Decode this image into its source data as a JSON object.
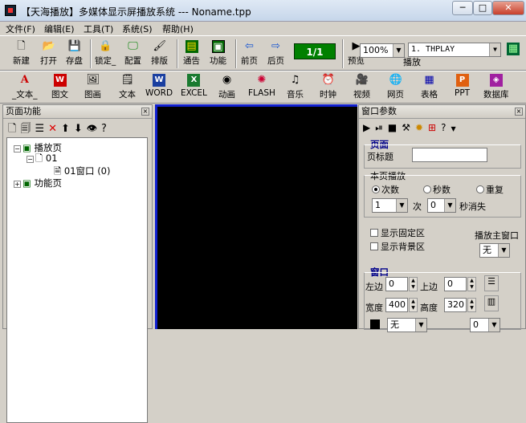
{
  "window": {
    "title": "【天海播放】多媒体显示屏播放系统 --- Noname.tpp",
    "minimize": "─",
    "maximize": "□",
    "close": "✕"
  },
  "menu": [
    "文件(F)",
    "编辑(E)",
    "工具(T)",
    "系统(S)",
    "帮助(H)"
  ],
  "toolbar1": {
    "new": "新建",
    "open": "打开",
    "save": "存盘",
    "lock": "锁定_",
    "config": "配置",
    "arrange": "排版",
    "notice": "通告",
    "function": "功能",
    "prev": "前页",
    "next": "后页",
    "page_counter": "1/1",
    "preview": "预览",
    "zoom": "100%",
    "play": "播放",
    "play_file": "1. THPLAY"
  },
  "toolbar2": [
    "_文本_",
    "图文",
    "图画",
    "文本",
    "WORD",
    "EXCEL",
    "动画",
    "FLASH",
    "音乐",
    "时钟",
    "视频",
    "网页",
    "表格",
    "PPT",
    "数据库"
  ],
  "left_panel": {
    "title": "页面功能",
    "close": "×",
    "tree": {
      "play_page": "播放页",
      "page_01": "01",
      "window_01": "01窗口 (0)",
      "func_page": "功能页"
    }
  },
  "right_panel": {
    "title": "窗口参数",
    "close": "×",
    "page_section": "页面",
    "page_title_label": "页标题",
    "page_title_value": "",
    "play_section": "本页播放",
    "radio_count": "次数",
    "radio_seconds": "秒数",
    "radio_repeat": "重复",
    "count_value": "1",
    "count_unit": "次",
    "seconds_value": "0",
    "seconds_unit": "秒消失",
    "show_fixed": "显示固定区",
    "show_bg": "显示背景区",
    "main_window": "播放主窗口",
    "main_window_value": "无",
    "window_section": "窗口",
    "left_label": "左边",
    "left_value": "0",
    "top_label": "上边",
    "top_value": "0",
    "width_label": "宽度",
    "width_value": "400",
    "height_label": "高度",
    "height_value": "320",
    "color_value": "无",
    "bottom_value": "0"
  }
}
